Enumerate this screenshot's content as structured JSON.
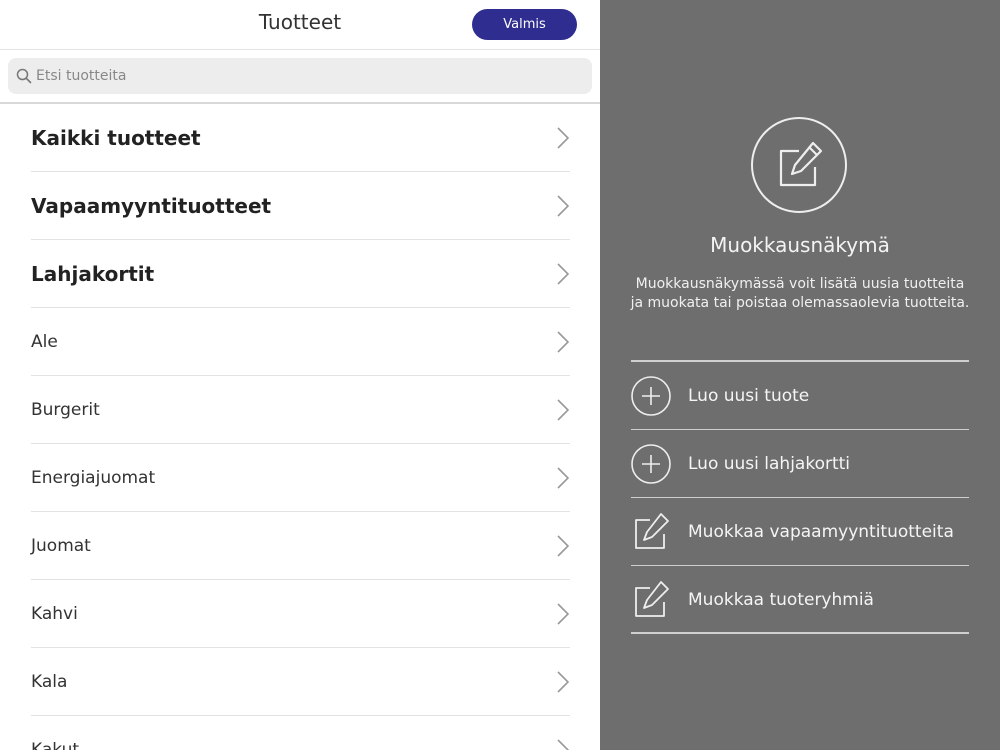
{
  "header": {
    "title": "Tuotteet",
    "done_label": "Valmis"
  },
  "search": {
    "placeholder": "Etsi tuotteita"
  },
  "categories": [
    {
      "label": "Kaikki tuotteet",
      "bold": true
    },
    {
      "label": "Vapaamyyntituotteet",
      "bold": true
    },
    {
      "label": "Lahjakortit",
      "bold": true
    },
    {
      "label": "Ale",
      "bold": false
    },
    {
      "label": "Burgerit",
      "bold": false
    },
    {
      "label": "Energiajuomat",
      "bold": false
    },
    {
      "label": "Juomat",
      "bold": false
    },
    {
      "label": "Kahvi",
      "bold": false
    },
    {
      "label": "Kala",
      "bold": false
    },
    {
      "label": "Kakut",
      "bold": false
    }
  ],
  "panel": {
    "title": "Muokkausnäkymä",
    "description": "Muokkausnäkymässä voit lisätä uusia tuotteita ja muokata tai poistaa olemassaolevia tuotteita.",
    "actions": [
      {
        "label": "Luo uusi tuote",
        "icon": "plus-circle-icon"
      },
      {
        "label": "Luo uusi lahjakortti",
        "icon": "plus-circle-icon"
      },
      {
        "label": "Muokkaa vapaamyyntituotteita",
        "icon": "edit-icon"
      },
      {
        "label": "Muokkaa tuoteryhmiä",
        "icon": "edit-icon"
      }
    ]
  },
  "colors": {
    "accent": "#2f2d8f",
    "panel_bg": "#6e6e6e"
  }
}
